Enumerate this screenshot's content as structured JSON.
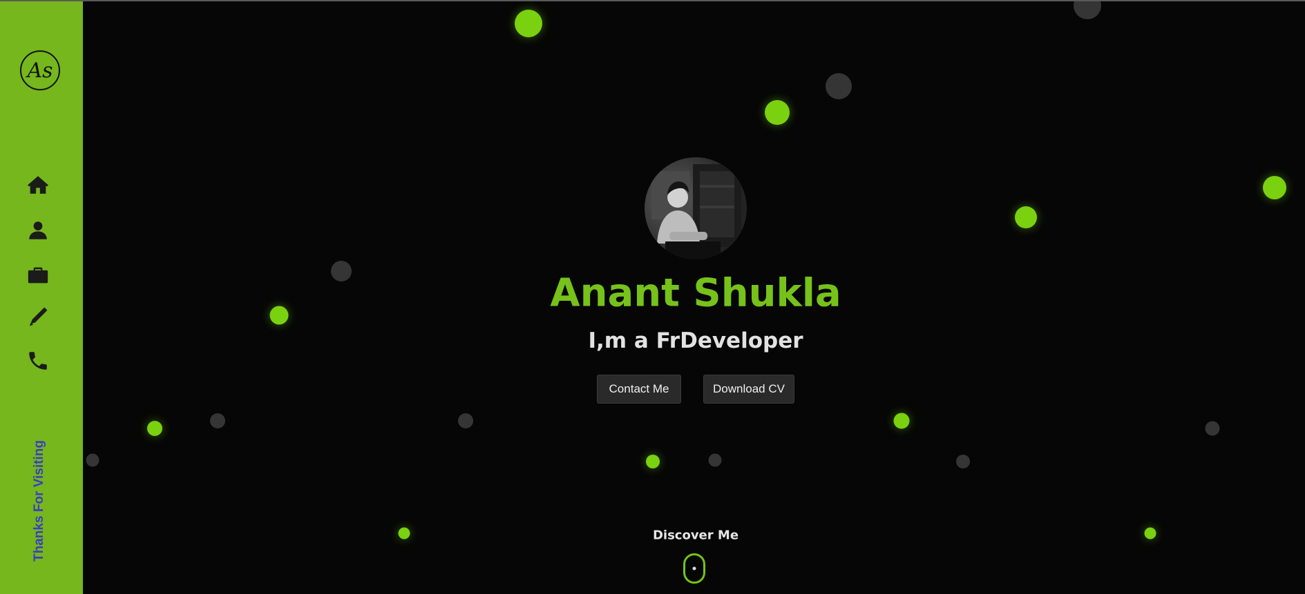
{
  "sidebar": {
    "logo_text": "As",
    "nav": [
      "home-icon",
      "user-icon",
      "briefcase-icon",
      "pen-icon",
      "phone-icon"
    ],
    "thanks_text": "Thanks For Visiting",
    "color": "#75b71c"
  },
  "hero": {
    "name": "Anant Shukla",
    "tagline": "I,m a FrDeveloper",
    "contact_label": "Contact Me",
    "download_label": "Download CV",
    "discover_label": "Discover Me"
  },
  "colors": {
    "accent": "#76c21a",
    "background": "#060606",
    "sidebar_text": "#3a3ec0"
  }
}
